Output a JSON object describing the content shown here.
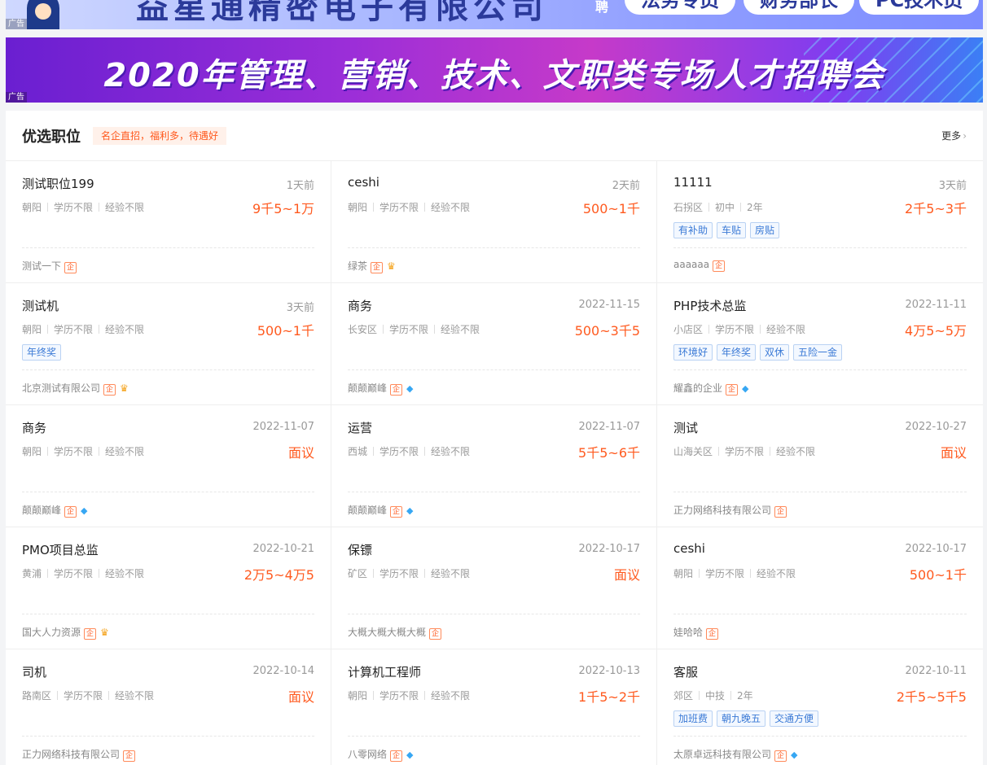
{
  "ads": {
    "ad_label": "广告",
    "top_company": "益星通精密电子有限公司",
    "top_hiring": "聘",
    "top_positions": [
      "法务专员",
      "财务部长",
      "PC技术员"
    ],
    "banner_headline": "2020年管理、营销、技术、文职类专场人才招聘会"
  },
  "section": {
    "title": "优选职位",
    "tag": "名企直招，福利多，待遇好",
    "more": "更多"
  },
  "jobs": [
    {
      "title": "测试职位199",
      "date": "1天前",
      "location": "朝阳",
      "education": "学历不限",
      "experience": "经验不限",
      "salary": "9千5~1万",
      "tags": [],
      "company": "测试一下",
      "verified": "企",
      "level": ""
    },
    {
      "title": "ceshi",
      "date": "2天前",
      "location": "朝阳",
      "education": "学历不限",
      "experience": "经验不限",
      "salary": "500~1千",
      "tags": [],
      "company": "绿茶",
      "verified": "企",
      "level": "crown"
    },
    {
      "title": "11111",
      "date": "3天前",
      "location": "石拐区",
      "education": "初中",
      "experience": "2年",
      "salary": "2千5~3千",
      "tags": [
        "有补助",
        "车贴",
        "房贴"
      ],
      "company": "aaaaaa",
      "verified": "企",
      "level": ""
    },
    {
      "title": "测试机",
      "date": "3天前",
      "location": "朝阳",
      "education": "学历不限",
      "experience": "经验不限",
      "salary": "500~1千",
      "tags": [
        "年终奖"
      ],
      "company": "北京测试有限公司",
      "verified": "企",
      "level": "crown"
    },
    {
      "title": "商务",
      "date": "2022-11-15",
      "location": "长安区",
      "education": "学历不限",
      "experience": "经验不限",
      "salary": "500~3千5",
      "tags": [],
      "company": "颠颠巅峰",
      "verified": "企",
      "level": "diamond"
    },
    {
      "title": "PHP技术总监",
      "date": "2022-11-11",
      "location": "小店区",
      "education": "学历不限",
      "experience": "经验不限",
      "salary": "4万5~5万",
      "tags": [
        "环境好",
        "年终奖",
        "双休",
        "五险一金"
      ],
      "company": "耀鑫的企业",
      "verified": "企",
      "level": "diamond"
    },
    {
      "title": "商务",
      "date": "2022-11-07",
      "location": "朝阳",
      "education": "学历不限",
      "experience": "经验不限",
      "salary": "面议",
      "tags": [],
      "company": "颠颠巅峰",
      "verified": "企",
      "level": "diamond"
    },
    {
      "title": "运营",
      "date": "2022-11-07",
      "location": "西城",
      "education": "学历不限",
      "experience": "经验不限",
      "salary": "5千5~6千",
      "tags": [],
      "company": "颠颠巅峰",
      "verified": "企",
      "level": "diamond"
    },
    {
      "title": "测试",
      "date": "2022-10-27",
      "location": "山海关区",
      "education": "学历不限",
      "experience": "经验不限",
      "salary": "面议",
      "tags": [],
      "company": "正力网络科技有限公司",
      "verified": "企",
      "level": ""
    },
    {
      "title": "PMO项目总监",
      "date": "2022-10-21",
      "location": "黄浦",
      "education": "学历不限",
      "experience": "经验不限",
      "salary": "2万5~4万5",
      "tags": [],
      "company": "国大人力资源",
      "verified": "企",
      "level": "crown"
    },
    {
      "title": "保镖",
      "date": "2022-10-17",
      "location": "矿区",
      "education": "学历不限",
      "experience": "经验不限",
      "salary": "面议",
      "tags": [],
      "company": "大概大概大概大概",
      "verified": "企",
      "level": ""
    },
    {
      "title": "ceshi",
      "date": "2022-10-17",
      "location": "朝阳",
      "education": "学历不限",
      "experience": "经验不限",
      "salary": "500~1千",
      "tags": [],
      "company": "娃哈哈",
      "verified": "企",
      "level": ""
    },
    {
      "title": "司机",
      "date": "2022-10-14",
      "location": "路南区",
      "education": "学历不限",
      "experience": "经验不限",
      "salary": "面议",
      "tags": [],
      "company": "正力网络科技有限公司",
      "verified": "企",
      "level": ""
    },
    {
      "title": "计算机工程师",
      "date": "2022-10-13",
      "location": "朝阳",
      "education": "学历不限",
      "experience": "经验不限",
      "salary": "1千5~2千",
      "tags": [],
      "company": "八零网络",
      "verified": "企",
      "level": "diamond"
    },
    {
      "title": "客服",
      "date": "2022-10-11",
      "location": "郊区",
      "education": "中技",
      "experience": "2年",
      "salary": "2千5~5千5",
      "tags": [
        "加班费",
        "朝九晚五",
        "交通方便"
      ],
      "company": "太原卓远科技有限公司",
      "verified": "企",
      "level": "diamond"
    }
  ],
  "colors": {
    "salary": "#ff5a1f",
    "tag_text": "#3b7ad6",
    "crown": "#f5a623",
    "diamond": "#37a7f3"
  },
  "icons": {
    "crown": "crown-icon",
    "diamond": "diamond-icon",
    "verified": "verified-enterprise-icon"
  }
}
